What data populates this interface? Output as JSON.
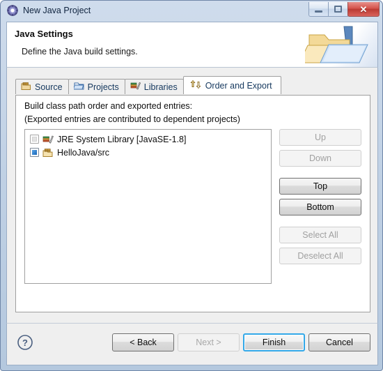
{
  "window": {
    "title": "New Java Project",
    "app_icon": "java-gear-icon",
    "controls": {
      "minimize": "minimize-icon",
      "maximize": "maximize-icon",
      "close": "close-icon",
      "close_glyph": "✕"
    }
  },
  "header": {
    "title": "Java Settings",
    "description": "Define the Java build settings.",
    "graphic": "java-folder-icon"
  },
  "tabs": [
    {
      "label": "Source",
      "icon": "package-folder-icon",
      "active": false
    },
    {
      "label": "Projects",
      "icon": "blue-folder-icon",
      "active": false
    },
    {
      "label": "Libraries",
      "icon": "books-icon",
      "active": false
    },
    {
      "label": "Order and Export",
      "icon": "order-arrows-icon",
      "active": true
    }
  ],
  "page": {
    "label_line1": "Build class path order and exported entries:",
    "label_line2": "(Exported entries are contributed to dependent projects)",
    "entries": [
      {
        "label": "JRE System Library [JavaSE-1.8]",
        "icon": "jre-library-icon",
        "checkbox_state": "grayed"
      },
      {
        "label": "HelloJava/src",
        "icon": "source-package-icon",
        "checkbox_state": "checked"
      }
    ],
    "side_buttons": [
      {
        "label": "Up",
        "enabled": false
      },
      {
        "label": "Down",
        "enabled": false
      },
      {
        "label": "Top",
        "enabled": true
      },
      {
        "label": "Bottom",
        "enabled": true
      },
      {
        "label": "Select All",
        "enabled": false
      },
      {
        "label": "Deselect All",
        "enabled": false
      }
    ]
  },
  "footer": {
    "help_icon": "help-question-icon",
    "buttons": [
      {
        "label": "< Back",
        "enabled": true,
        "default": false
      },
      {
        "label": "Next >",
        "enabled": false,
        "default": false
      },
      {
        "label": "Finish",
        "enabled": true,
        "default": true
      },
      {
        "label": "Cancel",
        "enabled": true,
        "default": false
      }
    ]
  },
  "colors": {
    "title_gradient_top": "#cfdcec",
    "title_gradient_bottom": "#b4c8de",
    "panel_bg": "#efefef",
    "list_bg": "#ffffff",
    "accent_focus": "#33a8e8",
    "close_red": "#d4534c",
    "checkbox_blue": "#1565b8"
  }
}
